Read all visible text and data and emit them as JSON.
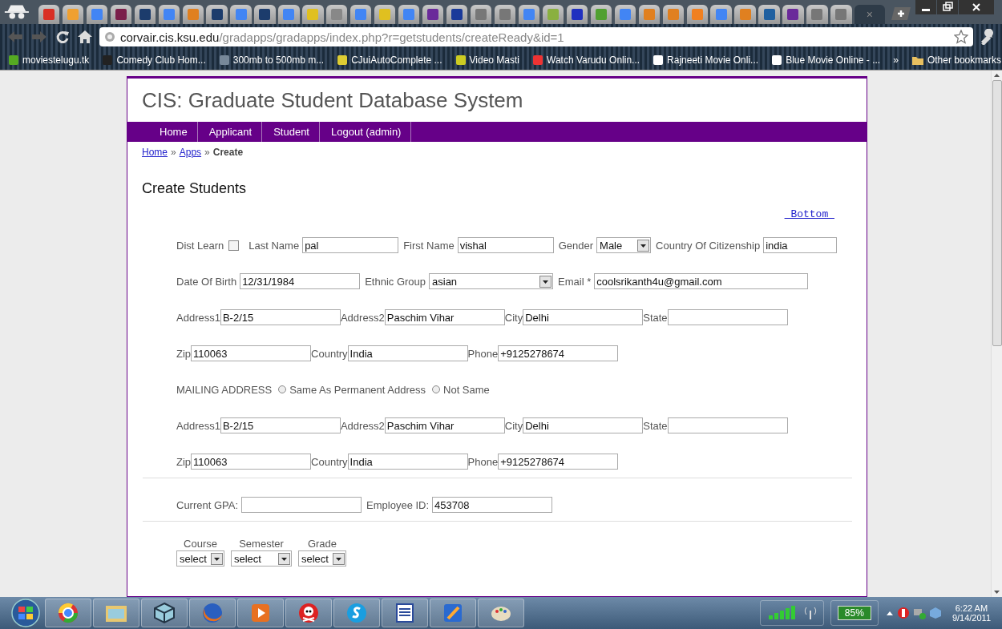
{
  "browser": {
    "tabs": [
      {
        "selected": false
      },
      {
        "selected": false
      },
      {
        "selected": false
      },
      {
        "selected": false
      },
      {
        "selected": false
      },
      {
        "selected": false
      },
      {
        "selected": false
      },
      {
        "selected": false
      },
      {
        "selected": false
      },
      {
        "selected": false
      },
      {
        "selected": false
      },
      {
        "selected": false
      },
      {
        "selected": false
      },
      {
        "selected": false
      },
      {
        "selected": false
      },
      {
        "selected": false
      },
      {
        "selected": false
      },
      {
        "selected": false
      },
      {
        "selected": false
      },
      {
        "selected": false
      },
      {
        "selected": false
      },
      {
        "selected": false
      },
      {
        "selected": false
      },
      {
        "selected": false
      },
      {
        "selected": false
      },
      {
        "selected": false
      },
      {
        "selected": false
      },
      {
        "selected": false
      },
      {
        "selected": false
      },
      {
        "selected": false
      },
      {
        "selected": false
      },
      {
        "selected": false
      },
      {
        "selected": false
      },
      {
        "selected": false
      },
      {
        "selected": true
      }
    ],
    "active_tab_close": "×",
    "url_host": "corvair.cis.ksu.edu",
    "url_path": "/gradapps/gradapps/index.php?r=getstudents/createReady&id=1",
    "bookmarks": [
      "moviestelugu.tk",
      "Comedy Club Hom...",
      "300mb to 500mb m...",
      "CJuiAutoComplete ...",
      "Video Masti",
      "Watch Varudu Onlin...",
      "Rajneeti Movie Onli...",
      "Blue Movie Online - ..."
    ],
    "bookmarks_overflow": "»",
    "other_bookmarks": "Other bookmarks"
  },
  "site": {
    "title": "CIS: Graduate Student Database System",
    "nav": [
      "Home",
      "Applicant",
      "Student",
      "Logout (admin)"
    ],
    "breadcrumb": [
      {
        "label": "Home",
        "kind": "link"
      },
      {
        "label": "»",
        "kind": "sep"
      },
      {
        "label": "Apps",
        "kind": "link"
      },
      {
        "label": "»",
        "kind": "sep"
      },
      {
        "label": "Create",
        "kind": "current"
      }
    ]
  },
  "page": {
    "heading": "Create Students",
    "bottom_link": " Bottom ",
    "rows": [
      {
        "fields": [
          {
            "kind": "checkbox",
            "label": "Dist Learn",
            "checked": false
          },
          {
            "kind": "text",
            "label": "Last Name",
            "value": "pal"
          },
          {
            "kind": "text",
            "label": "First Name",
            "value": "vishal"
          },
          {
            "kind": "select",
            "label": "Gender",
            "value": "Male"
          },
          {
            "kind": "text",
            "label": "Country Of Citizenship",
            "value": "india"
          }
        ]
      },
      {
        "fields": [
          {
            "kind": "text",
            "label": "Date Of Birth",
            "value": "12/31/1984"
          },
          {
            "kind": "select",
            "label": "Ethnic Group",
            "value": "asian"
          },
          {
            "kind": "text",
            "label": "Email *",
            "value": "coolsrikanth4u@gmail.com"
          }
        ]
      },
      {
        "fields": [
          {
            "kind": "text",
            "label": "Address1",
            "value": "B-2/15"
          },
          {
            "kind": "text",
            "label": "Address2",
            "value": "Paschim Vihar"
          },
          {
            "kind": "text",
            "label": "City",
            "value": "Delhi"
          },
          {
            "kind": "text",
            "label": "State"
          }
        ]
      },
      {
        "fields": [
          {
            "kind": "text",
            "label": "Zip",
            "value": "110063"
          },
          {
            "kind": "text",
            "label": "Country",
            "value": "India"
          },
          {
            "kind": "text",
            "label": "Phone",
            "value": "+9125278674"
          }
        ]
      },
      {
        "fields": [
          {
            "kind": "heading",
            "label": "MAILING ADDRESS"
          },
          {
            "kind": "radio",
            "label": "Same As Permanent Address",
            "selected": false
          },
          {
            "kind": "radio",
            "label": "Not Same",
            "selected": false
          }
        ]
      },
      {
        "fields": [
          {
            "kind": "text",
            "label": "Address1",
            "value": "B-2/15"
          },
          {
            "kind": "text",
            "label": "Address2",
            "value": "Paschim Vihar"
          },
          {
            "kind": "text",
            "label": "City",
            "value": "Delhi"
          },
          {
            "kind": "text",
            "label": "State"
          }
        ]
      },
      {
        "fields": [
          {
            "kind": "text",
            "label": "Zip",
            "value": "110063"
          },
          {
            "kind": "text",
            "label": "Country",
            "value": "India"
          },
          {
            "kind": "text",
            "label": "Phone",
            "value": "+9125278674"
          }
        ]
      },
      {
        "kind": "rule"
      },
      {
        "fields": [
          {
            "kind": "text",
            "label": "Current GPA:"
          },
          {
            "kind": "text",
            "label": "Employee ID:",
            "value": "453708"
          }
        ]
      },
      {
        "kind": "rule"
      }
    ],
    "courses": [
      {
        "label": "Course",
        "value": "select"
      },
      {
        "label": "Semester",
        "value": "select"
      },
      {
        "label": "Grade",
        "value": "select"
      }
    ]
  },
  "taskbar": {
    "battery": "85%",
    "time": "6:22 AM",
    "date": "9/14/2011"
  }
}
